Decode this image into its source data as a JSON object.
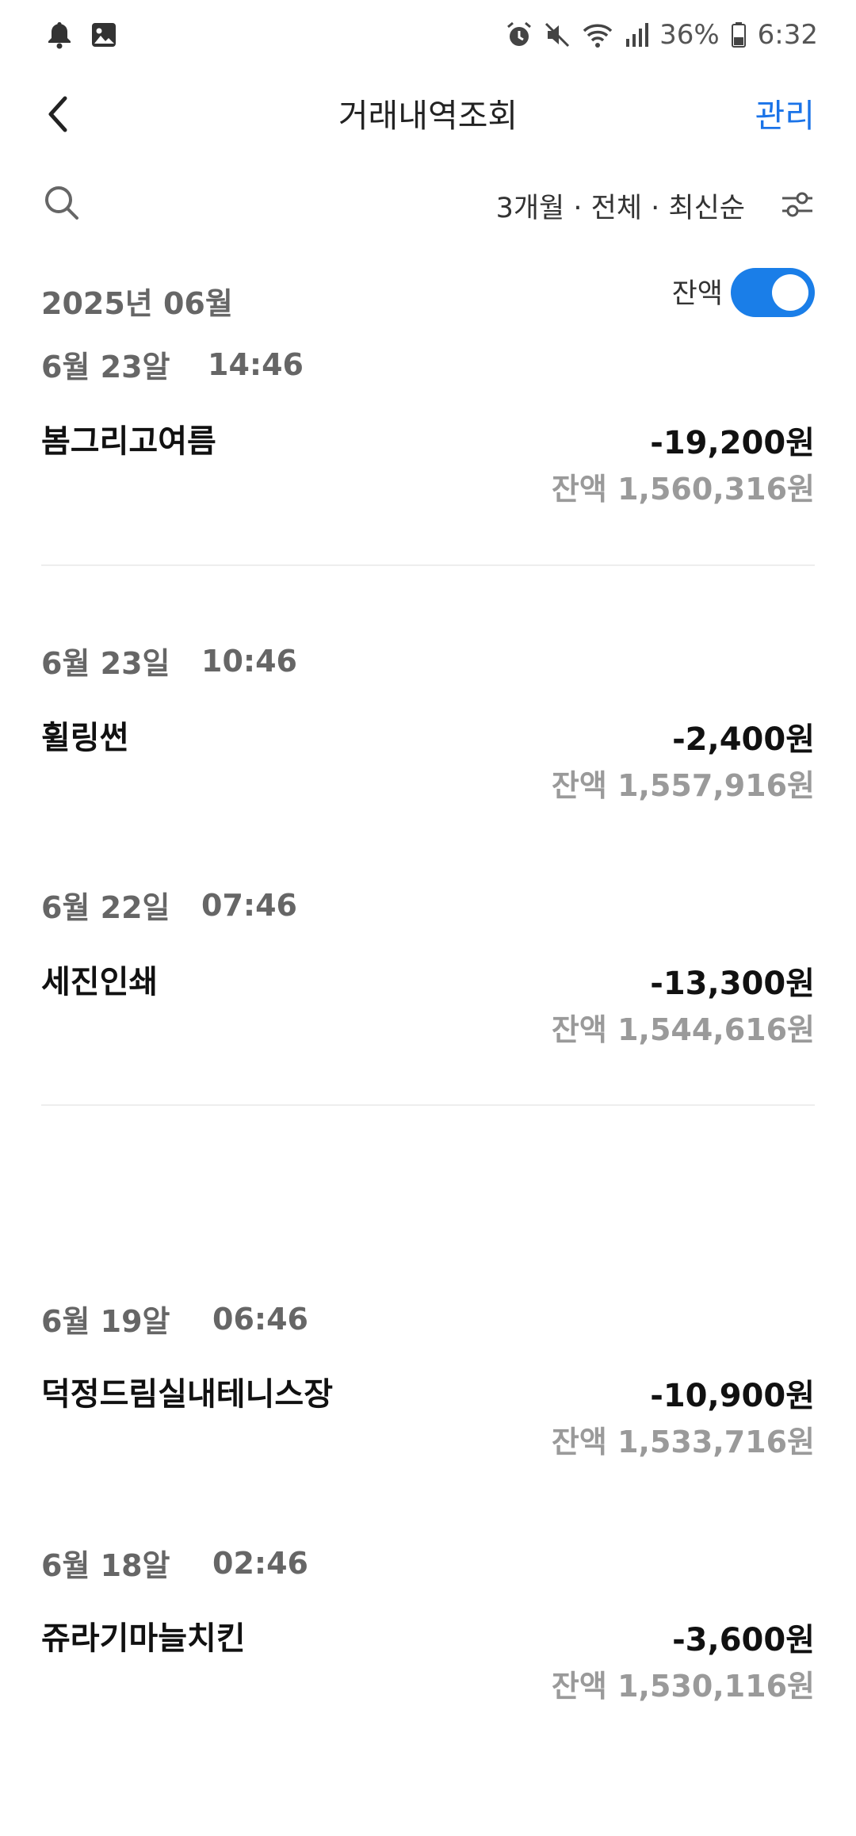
{
  "status_bar": {
    "battery": "36%",
    "time": "6:32",
    "icons": [
      "bell-icon",
      "image-icon",
      "alarm-icon",
      "mute-icon",
      "wifi-icon",
      "signal-icon",
      "battery-icon"
    ]
  },
  "header": {
    "title": "거래내역조회",
    "manage_label": "관리"
  },
  "filter": {
    "summary": "3개월 · 전체 · 최신순"
  },
  "month": {
    "label": "2025년 06월"
  },
  "balance_toggle": {
    "label": "잔액",
    "on": true
  },
  "transactions": [
    {
      "date": "6월 23알",
      "time": "14:46",
      "name": "봄그리고여름",
      "amount": "-19,200원",
      "balance": "잔액 1,560,316원"
    },
    {
      "date": "6월 23일",
      "time": "10:46",
      "name": "휠링썬",
      "amount": "-2,400원",
      "balance": "잔액 1,557,916원"
    },
    {
      "date": "6월 22일",
      "time": "07:46",
      "name": "세진인쇄",
      "amount": "-13,300원",
      "balance": "잔액 1,544,616원"
    },
    {
      "date": "6월 19알",
      "time": "06:46",
      "name": "덕정드림실내테니스장",
      "amount": "-10,900원",
      "balance": "잔액 1,533,716원"
    },
    {
      "date": "6월 18알",
      "time": "02:46",
      "name": "쥬라기마늘치킨",
      "amount": "-3,600원",
      "balance": "잔액 1,530,116원"
    }
  ],
  "colors": {
    "accent": "#1a73e8",
    "toggle_on": "#1a7ee8",
    "muted": "#9a9a9a"
  }
}
